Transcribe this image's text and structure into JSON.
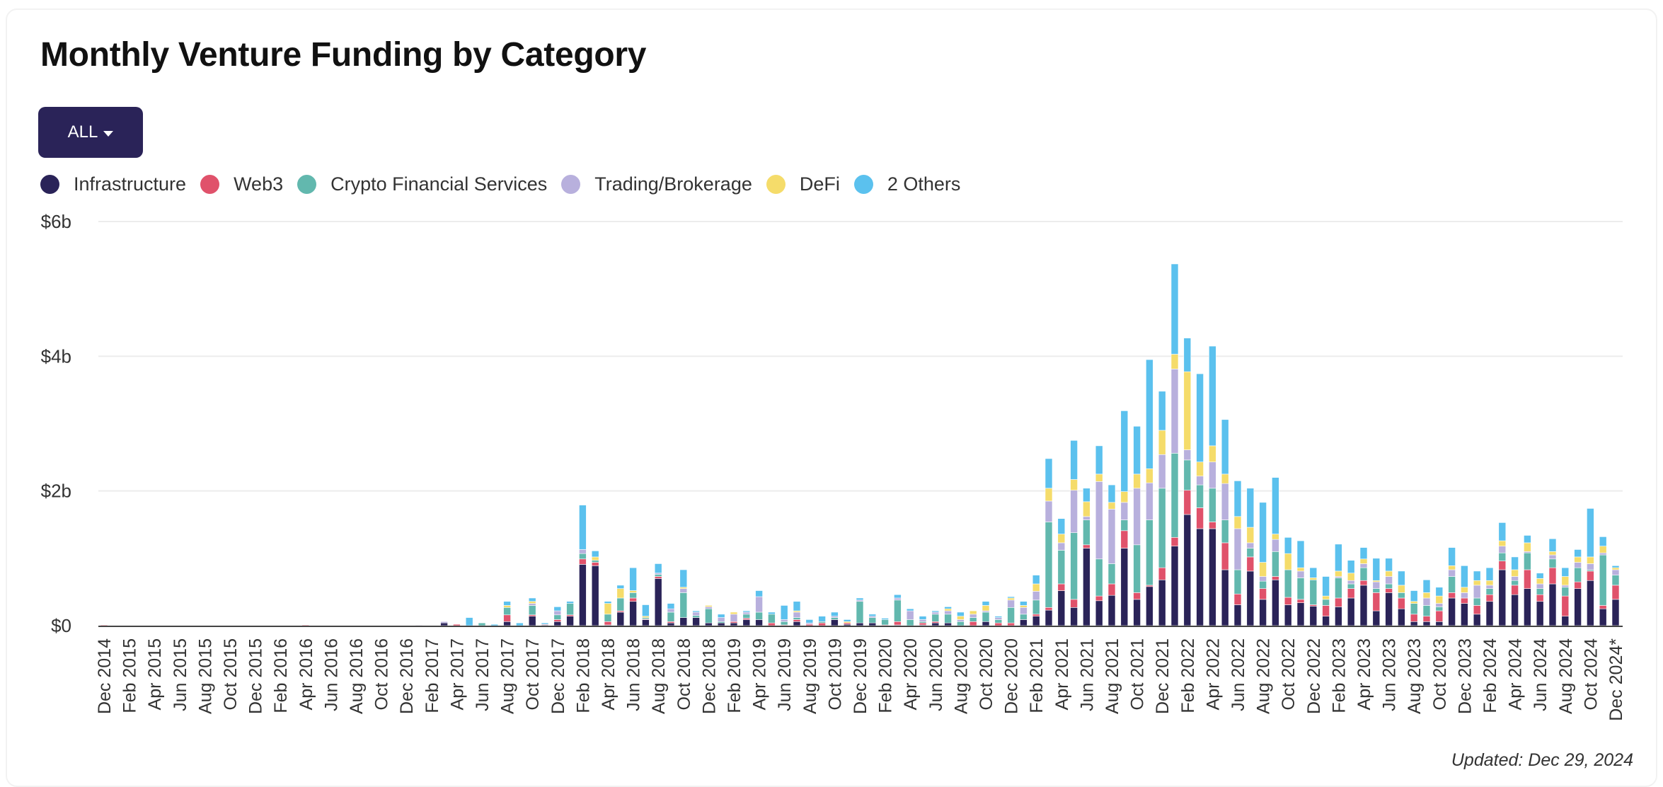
{
  "card": {
    "title": "Monthly Venture Funding by Category",
    "filter": {
      "label": "ALL",
      "icon": "caret-down-icon"
    },
    "updated": "Updated: Dec 29, 2024"
  },
  "chart_data": {
    "type": "bar",
    "stacked": true,
    "title": "Monthly Venture Funding by Category",
    "xlabel": "",
    "ylabel": "",
    "ylim": [
      0,
      6
    ],
    "y_unit": "$ billions",
    "y_ticks": [
      0,
      2,
      4,
      6
    ],
    "y_tick_labels": [
      "$0",
      "$2b",
      "$4b",
      "$6b"
    ],
    "grid": true,
    "legend_position": "top-left",
    "x_tick_every": 2,
    "series": [
      {
        "name": "Infrastructure",
        "color": "#2a2358"
      },
      {
        "name": "Web3",
        "color": "#e0526b"
      },
      {
        "name": "Crypto Financial Services",
        "color": "#62b8ae"
      },
      {
        "name": "Trading/Brokerage",
        "color": "#b8b0dd"
      },
      {
        "name": "DeFi",
        "color": "#f5dc6a"
      },
      {
        "name": "2 Others",
        "color": "#5bc1ee"
      }
    ],
    "categories": [
      "Dec 2014",
      "Jan 2015",
      "Feb 2015",
      "Mar 2015",
      "Apr 2015",
      "May 2015",
      "Jun 2015",
      "Jul 2015",
      "Aug 2015",
      "Sep 2015",
      "Oct 2015",
      "Nov 2015",
      "Dec 2015",
      "Jan 2016",
      "Feb 2016",
      "Mar 2016",
      "Apr 2016",
      "May 2016",
      "Jun 2016",
      "Jul 2016",
      "Aug 2016",
      "Sep 2016",
      "Oct 2016",
      "Nov 2016",
      "Dec 2016",
      "Jan 2017",
      "Feb 2017",
      "Mar 2017",
      "Apr 2017",
      "May 2017",
      "Jun 2017",
      "Jul 2017",
      "Aug 2017",
      "Sep 2017",
      "Oct 2017",
      "Nov 2017",
      "Dec 2017",
      "Jan 2018",
      "Feb 2018",
      "Mar 2018",
      "Apr 2018",
      "May 2018",
      "Jun 2018",
      "Jul 2018",
      "Aug 2018",
      "Sep 2018",
      "Oct 2018",
      "Nov 2018",
      "Dec 2018",
      "Jan 2019",
      "Feb 2019",
      "Mar 2019",
      "Apr 2019",
      "May 2019",
      "Jun 2019",
      "Jul 2019",
      "Aug 2019",
      "Sep 2019",
      "Oct 2019",
      "Nov 2019",
      "Dec 2019",
      "Jan 2020",
      "Feb 2020",
      "Mar 2020",
      "Apr 2020",
      "May 2020",
      "Jun 2020",
      "Jul 2020",
      "Aug 2020",
      "Sep 2020",
      "Oct 2020",
      "Nov 2020",
      "Dec 2020",
      "Jan 2021",
      "Feb 2021",
      "Mar 2021",
      "Apr 2021",
      "May 2021",
      "Jun 2021",
      "Jul 2021",
      "Aug 2021",
      "Sep 2021",
      "Oct 2021",
      "Nov 2021",
      "Dec 2021",
      "Jan 2022",
      "Feb 2022",
      "Mar 2022",
      "Apr 2022",
      "May 2022",
      "Jun 2022",
      "Jul 2022",
      "Aug 2022",
      "Sep 2022",
      "Oct 2022",
      "Nov 2022",
      "Dec 2022",
      "Jan 2023",
      "Feb 2023",
      "Mar 2023",
      "Apr 2023",
      "May 2023",
      "Jun 2023",
      "Jul 2023",
      "Aug 2023",
      "Sep 2023",
      "Oct 2023",
      "Nov 2023",
      "Dec 2023",
      "Jan 2024",
      "Feb 2024",
      "Mar 2024",
      "Apr 2024",
      "May 2024",
      "Jun 2024",
      "Jul 2024",
      "Aug 2024",
      "Sep 2024",
      "Oct 2024",
      "Nov 2024",
      "Dec 2024*"
    ],
    "values_order": [
      "Infrastructure",
      "Web3",
      "Crypto Financial Services",
      "Trading/Brokerage",
      "DeFi",
      "2 Others"
    ],
    "values": [
      [
        0,
        0.01,
        0,
        0,
        0,
        0
      ],
      [
        0,
        0,
        0,
        0,
        0,
        0
      ],
      [
        0,
        0,
        0,
        0,
        0,
        0
      ],
      [
        0,
        0,
        0,
        0,
        0,
        0
      ],
      [
        0,
        0,
        0,
        0,
        0,
        0
      ],
      [
        0,
        0,
        0,
        0,
        0,
        0
      ],
      [
        0,
        0,
        0,
        0,
        0,
        0
      ],
      [
        0,
        0,
        0,
        0,
        0,
        0
      ],
      [
        0,
        0,
        0,
        0,
        0,
        0
      ],
      [
        0,
        0,
        0,
        0,
        0,
        0
      ],
      [
        0,
        0,
        0,
        0,
        0,
        0
      ],
      [
        0,
        0,
        0,
        0,
        0,
        0
      ],
      [
        0,
        0,
        0,
        0,
        0,
        0
      ],
      [
        0,
        0,
        0,
        0,
        0,
        0
      ],
      [
        0,
        0,
        0,
        0,
        0,
        0
      ],
      [
        0,
        0,
        0,
        0,
        0,
        0
      ],
      [
        0,
        0.01,
        0,
        0,
        0,
        0
      ],
      [
        0,
        0,
        0,
        0,
        0,
        0
      ],
      [
        0,
        0,
        0,
        0,
        0,
        0
      ],
      [
        0,
        0,
        0,
        0,
        0,
        0
      ],
      [
        0,
        0,
        0,
        0,
        0,
        0
      ],
      [
        0,
        0,
        0,
        0,
        0,
        0
      ],
      [
        0,
        0,
        0,
        0,
        0,
        0
      ],
      [
        0,
        0,
        0,
        0,
        0,
        0
      ],
      [
        0,
        0,
        0,
        0,
        0,
        0
      ],
      [
        0,
        0,
        0,
        0.005,
        0,
        0
      ],
      [
        0,
        0,
        0,
        0,
        0,
        0
      ],
      [
        0.04,
        0,
        0,
        0.02,
        0,
        0
      ],
      [
        0,
        0.02,
        0,
        0,
        0,
        0
      ],
      [
        0,
        0,
        0,
        0,
        0,
        0.12
      ],
      [
        0,
        0,
        0.04,
        0,
        0,
        0
      ],
      [
        0,
        0,
        0,
        0,
        0,
        0.02
      ],
      [
        0.06,
        0.1,
        0.11,
        0,
        0.03,
        0.06
      ],
      [
        0,
        0,
        0,
        0,
        0,
        0.04
      ],
      [
        0.14,
        0.02,
        0.14,
        0.03,
        0.03,
        0.05
      ],
      [
        0.01,
        0.01,
        0,
        0,
        0,
        0.02
      ],
      [
        0.06,
        0.03,
        0.07,
        0.06,
        0,
        0.06
      ],
      [
        0.14,
        0.02,
        0.17,
        0,
        0,
        0.03
      ],
      [
        0.91,
        0.08,
        0.08,
        0.06,
        0,
        0.66
      ],
      [
        0.89,
        0.05,
        0.03,
        0,
        0.05,
        0.09
      ],
      [
        0.01,
        0.05,
        0.11,
        0,
        0.16,
        0.03
      ],
      [
        0.2,
        0.02,
        0.19,
        0,
        0.14,
        0.05
      ],
      [
        0.36,
        0.05,
        0.08,
        0,
        0.03,
        0.34
      ],
      [
        0.09,
        0.01,
        0.02,
        0,
        0.02,
        0.17
      ],
      [
        0.7,
        0.03,
        0.03,
        0.02,
        0,
        0.14
      ],
      [
        0.04,
        0.02,
        0.14,
        0.05,
        0,
        0.08
      ],
      [
        0.12,
        0,
        0.37,
        0.06,
        0.02,
        0.26
      ],
      [
        0.12,
        0,
        0.03,
        0.05,
        0,
        0.02
      ],
      [
        0.04,
        0,
        0.21,
        0.03,
        0.02,
        0
      ],
      [
        0.04,
        0,
        0.02,
        0.06,
        0,
        0.05
      ],
      [
        0.04,
        0.02,
        0,
        0.11,
        0.03,
        0
      ],
      [
        0.09,
        0.02,
        0.06,
        0.03,
        0,
        0.02
      ],
      [
        0.09,
        0,
        0.11,
        0.23,
        0,
        0.09
      ],
      [
        0,
        0.04,
        0.13,
        0,
        0,
        0.03
      ],
      [
        0,
        0.01,
        0.05,
        0.03,
        0,
        0.21
      ],
      [
        0.06,
        0.03,
        0.03,
        0.08,
        0.02,
        0.14
      ],
      [
        0,
        0.02,
        0,
        0.02,
        0,
        0.05
      ],
      [
        0,
        0.04,
        0.02,
        0,
        0,
        0.08
      ],
      [
        0.09,
        0,
        0.03,
        0.02,
        0,
        0.06
      ],
      [
        0.02,
        0.02,
        0,
        0,
        0.02,
        0.03
      ],
      [
        0.04,
        0,
        0.32,
        0.02,
        0,
        0.03
      ],
      [
        0.04,
        0,
        0.08,
        0.02,
        0,
        0.03
      ],
      [
        0,
        0.01,
        0.08,
        0,
        0,
        0.02
      ],
      [
        0.01,
        0.05,
        0.32,
        0.03,
        0,
        0.05
      ],
      [
        0,
        0,
        0.09,
        0.13,
        0,
        0.03
      ],
      [
        0.01,
        0.03,
        0.02,
        0.03,
        0,
        0.05
      ],
      [
        0.04,
        0.02,
        0.11,
        0.03,
        0,
        0.02
      ],
      [
        0.04,
        0,
        0.13,
        0.05,
        0.03,
        0.03
      ],
      [
        0,
        0,
        0.06,
        0.03,
        0.05,
        0.06
      ],
      [
        0,
        0.06,
        0.06,
        0.05,
        0.05,
        0
      ],
      [
        0.06,
        0,
        0.14,
        0.02,
        0.08,
        0.06
      ],
      [
        0,
        0.04,
        0.05,
        0.03,
        0,
        0.02
      ],
      [
        0,
        0.04,
        0.23,
        0.11,
        0.03,
        0.02
      ],
      [
        0.09,
        0,
        0.08,
        0.1,
        0.03,
        0.06
      ],
      [
        0.14,
        0.03,
        0.21,
        0.13,
        0.11,
        0.13
      ],
      [
        0.23,
        0.04,
        1.27,
        0.31,
        0.19,
        0.44
      ],
      [
        0.52,
        0.1,
        0.5,
        0.11,
        0.13,
        0.23
      ],
      [
        0.27,
        0.12,
        0.99,
        0.63,
        0.16,
        0.58
      ],
      [
        1.15,
        0.05,
        0.37,
        0.05,
        0.22,
        0.2
      ],
      [
        0.37,
        0.07,
        0.55,
        1.15,
        0.11,
        0.42
      ],
      [
        0.45,
        0.17,
        0.3,
        0.81,
        0.1,
        0.26
      ],
      [
        1.15,
        0.26,
        0.16,
        0.26,
        0.16,
        1.2
      ],
      [
        0.39,
        0.1,
        0.71,
        0.84,
        0.21,
        0.71
      ],
      [
        0.58,
        0.02,
        0.97,
        0.55,
        0.21,
        1.62
      ],
      [
        0.68,
        0.18,
        1.18,
        0.5,
        0.36,
        0.58
      ],
      [
        1.18,
        0.13,
        1.25,
        1.25,
        0.22,
        1.34
      ],
      [
        1.65,
        0.36,
        0.45,
        0.15,
        1.16,
        0.5
      ],
      [
        1.44,
        0.31,
        0.34,
        0.13,
        0.21,
        1.31
      ],
      [
        1.44,
        0.1,
        0.5,
        0.39,
        0.24,
        1.48
      ],
      [
        0.83,
        0.4,
        0.34,
        0.54,
        0.14,
        0.81
      ],
      [
        0.31,
        0.16,
        0.36,
        0.61,
        0.18,
        0.53
      ],
      [
        0.81,
        0.21,
        0.13,
        0.08,
        0.23,
        0.58
      ],
      [
        0.39,
        0.16,
        0.11,
        0.07,
        0.21,
        0.89
      ],
      [
        0.68,
        0.05,
        0.37,
        0.18,
        0.08,
        0.84
      ],
      [
        0.31,
        0.11,
        0.41,
        0,
        0.24,
        0.24
      ],
      [
        0.34,
        0.05,
        0.32,
        0.1,
        0.05,
        0.4
      ],
      [
        0.29,
        0.02,
        0.37,
        0,
        0.03,
        0.15
      ],
      [
        0.14,
        0.16,
        0.09,
        0,
        0.05,
        0.29
      ],
      [
        0.28,
        0.13,
        0.3,
        0.02,
        0.08,
        0.4
      ],
      [
        0.41,
        0.14,
        0.07,
        0.05,
        0.11,
        0.19
      ],
      [
        0.6,
        0.07,
        0.19,
        0.06,
        0.07,
        0.17
      ],
      [
        0.22,
        0.27,
        0.06,
        0.1,
        0.02,
        0.33
      ],
      [
        0.49,
        0.06,
        0.07,
        0.11,
        0.08,
        0.19
      ],
      [
        0.25,
        0.16,
        0.08,
        0,
        0.11,
        0.21
      ],
      [
        0.06,
        0.11,
        0.16,
        0,
        0.03,
        0.16
      ],
      [
        0.06,
        0.08,
        0.16,
        0.11,
        0.08,
        0.19
      ],
      [
        0.06,
        0.16,
        0.06,
        0.05,
        0.11,
        0.13
      ],
      [
        0.41,
        0.08,
        0.24,
        0.1,
        0.06,
        0.27
      ],
      [
        0.33,
        0.08,
        0,
        0.08,
        0.08,
        0.32
      ],
      [
        0.17,
        0.13,
        0.11,
        0.19,
        0.07,
        0.14
      ],
      [
        0.36,
        0.1,
        0.09,
        0.05,
        0.07,
        0.19
      ],
      [
        0.83,
        0.13,
        0.12,
        0.1,
        0.08,
        0.27
      ],
      [
        0.46,
        0.14,
        0.07,
        0.06,
        0.1,
        0.19
      ],
      [
        0.55,
        0.28,
        0.25,
        0.02,
        0.13,
        0.11
      ],
      [
        0.36,
        0.1,
        0.09,
        0.07,
        0.08,
        0.08
      ],
      [
        0.62,
        0.24,
        0.13,
        0.06,
        0.05,
        0.19
      ],
      [
        0.14,
        0.3,
        0.13,
        0.03,
        0.13,
        0.13
      ],
      [
        0.55,
        0.1,
        0.21,
        0.08,
        0.08,
        0.11
      ],
      [
        0.67,
        0.14,
        0.02,
        0.09,
        0.1,
        0.72
      ],
      [
        0.25,
        0.05,
        0.75,
        0.03,
        0.1,
        0.14
      ],
      [
        0.39,
        0.21,
        0.15,
        0.08,
        0.03,
        0.03
      ]
    ]
  }
}
